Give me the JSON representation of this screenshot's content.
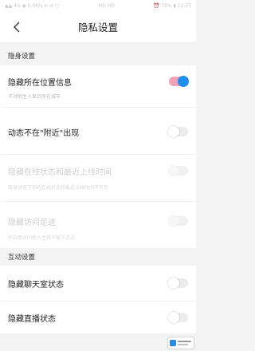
{
  "status_bar": {
    "left": "▲▲ 4G ◉ 0.0K/s ⊘ ✉ ▢",
    "center": "HD HD",
    "right": "⏰ 75% ▮ 12:57"
  },
  "header": {
    "back_icon": "chevron-left-icon",
    "title": "隐私设置"
  },
  "sections": {
    "stealth": {
      "header": "隐身设置",
      "items": [
        {
          "label": "隐藏所在位置信息",
          "desc": "不对陌生人显示所在城市",
          "enabled": true,
          "toggle_on": true
        },
        {
          "label": "动态不在\"附近\"出现",
          "desc": "",
          "enabled": true,
          "toggle_on": false
        },
        {
          "label": "隐藏在线状态和最近上线时间",
          "desc": "隐身状态下你的在线状态和最近上线时间不可见",
          "enabled": false,
          "toggle_on": false
        },
        {
          "label": "隐藏访问足迹",
          "desc": "开启后访问他人主页不留下足迹",
          "enabled": false,
          "toggle_on": false
        }
      ]
    },
    "interaction": {
      "header": "互动设置",
      "items": [
        {
          "label": "隐藏聊天室状态",
          "desc": "",
          "enabled": true,
          "toggle_on": false
        },
        {
          "label": "隐藏直播状态",
          "desc": "",
          "enabled": true,
          "toggle_on": false
        }
      ]
    }
  },
  "colors": {
    "accent": "#1e8ff0",
    "toggle_on_track": "#f3a1b6",
    "background": "#f3f3f3"
  }
}
